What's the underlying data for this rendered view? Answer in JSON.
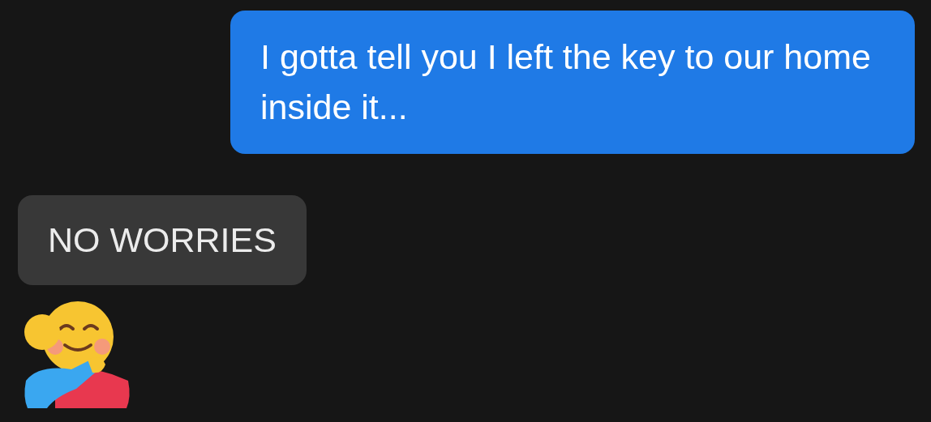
{
  "messages": [
    {
      "kind": "sent",
      "text": "I gotta tell you I left the key to our home inside it..."
    },
    {
      "kind": "received",
      "text": "NO WORRIES"
    },
    {
      "kind": "emoji"
    }
  ]
}
